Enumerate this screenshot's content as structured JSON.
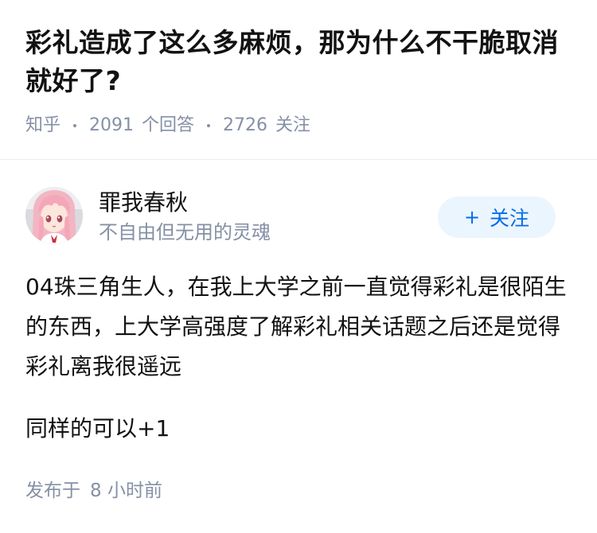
{
  "question": {
    "title": "彩礼造成了这么多麻烦，那为什么不干脆取消就好了?",
    "source": "知乎",
    "answer_count": "2091",
    "answer_label": "个回答",
    "follower_count": "2726",
    "follower_label": "关注"
  },
  "answer": {
    "author": {
      "name": "罪我春秋",
      "bio": "不自由但无用的灵魂",
      "avatar_icon": "anime-girl-avatar"
    },
    "follow_button": {
      "icon": "+",
      "label": "关注"
    },
    "paragraphs": [
      "04珠三角生人，在我上大学之前一直觉得彩礼是很陌生的东西，上大学高强度了解彩礼相关话题之后还是觉得彩礼离我很遥远",
      "同样的可以+1"
    ],
    "publish": {
      "label": "发布于",
      "time": "8 小时前"
    }
  },
  "colors": {
    "text": "#121212",
    "meta": "#8590a6",
    "accent": "#056de8",
    "button_bg": "#ebf5fd",
    "divider": "#ebebeb"
  }
}
